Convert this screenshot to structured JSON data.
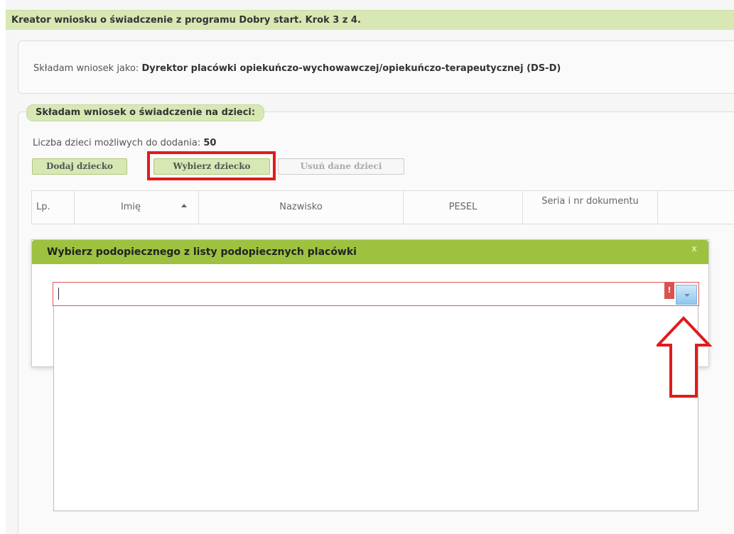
{
  "wizard": {
    "title": "Kreator wniosku o świadczenie z programu Dobry start. Krok 3 z 4."
  },
  "applicant": {
    "prefix": "Składam wniosek jako:",
    "role": "Dyrektor placówki opiekuńczo-wychowawczej/opiekuńczo-terapeutycznej (DS-D)"
  },
  "children": {
    "legend": "Składam wniosek o świadczenie na dzieci:",
    "count_label": "Liczba dzieci możliwych do dodania:",
    "count_value": "50",
    "buttons": {
      "add": "Dodaj dziecko",
      "pick": "Wybierz dziecko",
      "remove": "Usuń dane dzieci"
    },
    "table": {
      "columns": [
        "Lp.",
        "Imię",
        "Nazwisko",
        "PESEL",
        "Seria i nr dokumentu",
        ""
      ]
    }
  },
  "modal": {
    "title": "Wybierz podopiecznego z listy podopiecznych placówki",
    "close": "x",
    "combo": {
      "value": "",
      "error_mark": "!"
    }
  },
  "colors": {
    "header": "#d8e8b4",
    "modal_header": "#9dc23f",
    "highlight": "#e11b1b"
  }
}
